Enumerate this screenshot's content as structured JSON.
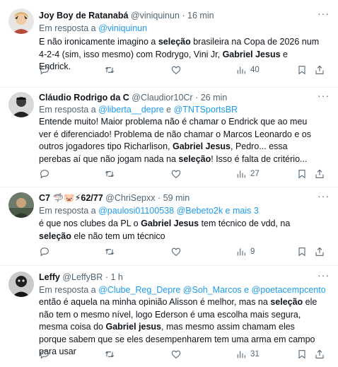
{
  "tweets": [
    {
      "name": "Joy Boy de Ratanabá",
      "handle": "@viniquinun",
      "sep": "·",
      "time": "16 min",
      "reply_prefix": "Em resposta a ",
      "reply_to": "@viniquinun",
      "reply_mid": "",
      "reply_to2": "",
      "text": [
        {
          "t": "E não ironicamente imagino a "
        },
        {
          "t": "seleção",
          "b": true
        },
        {
          "t": " brasileira na Copa de 2026 num 4-2-4 (sim, isso mesmo) com Rodrygo, Vini Jr, "
        },
        {
          "t": "Gabriel Jesus",
          "b": true
        },
        {
          "t": " e Endrick."
        }
      ],
      "views": "40"
    },
    {
      "name": "Cláudio Rodrigo da C",
      "handle": "@Claudior10Cr",
      "sep": "·",
      "time": "26 min",
      "reply_prefix": "Em resposta a ",
      "reply_to": "@liberta__depre",
      "reply_mid": " e ",
      "reply_to2": "@TNTSportsBR",
      "text": [
        {
          "t": "Entende muito! Maior problema não é chamar o Endrick que ao meu ver é diferenciado! Problema de não chamar o Marcos Leonardo e os outros jogadores tipo Richarlison, "
        },
        {
          "t": "Gabriel Jesus",
          "b": true
        },
        {
          "t": ", Pedro... essa perebas  aí que não jogam nada na "
        },
        {
          "t": "seleção",
          "b": true
        },
        {
          "t": "! Isso é falta de critério..."
        }
      ],
      "views": "27"
    },
    {
      "name": "C7",
      "name_emoji": "🦈🐷⚡",
      "name_suffix": "62/77",
      "handle": "@ChriSepxx",
      "sep": "·",
      "time": "59 min",
      "reply_prefix": "Em resposta a ",
      "reply_to": "@paulosi01100538",
      "reply_mid": " ",
      "reply_to2": "@Bebeto2k e mais 3",
      "text": [
        {
          "t": "é que nos clubes da PL o "
        },
        {
          "t": "Gabriel Jesus",
          "b": true
        },
        {
          "t": " tem técnico de vdd, na "
        },
        {
          "t": "seleção",
          "b": true
        },
        {
          "t": " ele não tem um técnico"
        }
      ],
      "views": "9"
    },
    {
      "name": "Leffy",
      "handle": "@LeffyBR",
      "sep": "·",
      "time": "1 h",
      "reply_prefix": "Em resposta a ",
      "reply_to": "@Clube_Reg_Depre",
      "reply_mid": " ",
      "reply_to2": "@Soh_Marcos e @poetacempcento",
      "text": [
        {
          "t": "então é aquela na minha opinião Alisson é melhor, mas na "
        },
        {
          "t": "seleção",
          "b": true
        },
        {
          "t": " ele não tem o mesmo nível, logo Ederson é uma escolha mais segura, mesma coisa do "
        },
        {
          "t": "Gabriel jesus",
          "b": true
        },
        {
          "t": ", mas mesmo assim chamam eles porque sabem que se eles desempenharem tem uma arma em campo para usar"
        }
      ],
      "views": "31"
    }
  ],
  "icons": [
    "more-icon",
    "reply-icon",
    "retweet-icon",
    "like-icon",
    "views-icon",
    "bookmark-icon",
    "share-icon"
  ],
  "colors": {
    "link": "#1d9bf0",
    "muted": "#536471",
    "text": "#0f1419",
    "divider": "#eff3f4"
  }
}
